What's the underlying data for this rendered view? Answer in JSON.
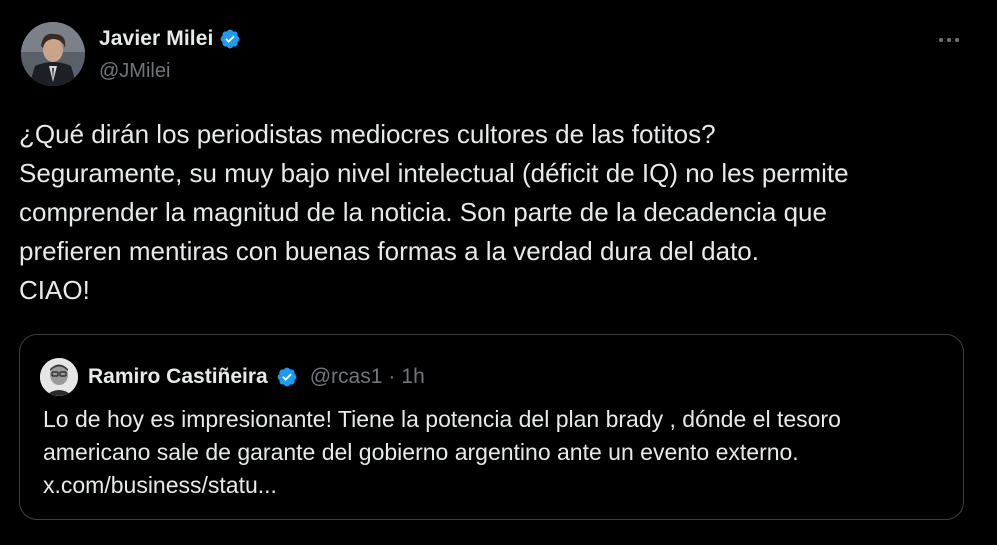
{
  "author": {
    "name": "Javier Milei",
    "handle": "@JMilei",
    "verified": true
  },
  "more_icon": "more-horizontal-icon",
  "tweet": {
    "lines": [
      "¿Qué dirán los periodistas mediocres cultores de las fotitos?",
      "Seguramente, su muy bajo nivel intelectual (déficit de IQ) no les permite",
      "comprender la magnitud de la noticia. Son parte de la decadencia que",
      "prefieren mentiras con buenas formas a la verdad dura del dato.",
      "CIAO!"
    ]
  },
  "quote": {
    "name": "Ramiro Castiñeira",
    "handle": "@rcas1",
    "separator": "·",
    "time": "1h",
    "verified": true,
    "lines": [
      "Lo de hoy es impresionante! Tiene la potencia del plan brady , dónde el tesoro",
      "americano sale de garante del gobierno argentino ante un evento externo.",
      "x.com/business/statu..."
    ]
  },
  "colors": {
    "background": "#000000",
    "text_primary": "#e7e9ea",
    "text_secondary": "#71767b",
    "verified_blue": "#1d9bf0",
    "card_border": "#3b3f44"
  }
}
